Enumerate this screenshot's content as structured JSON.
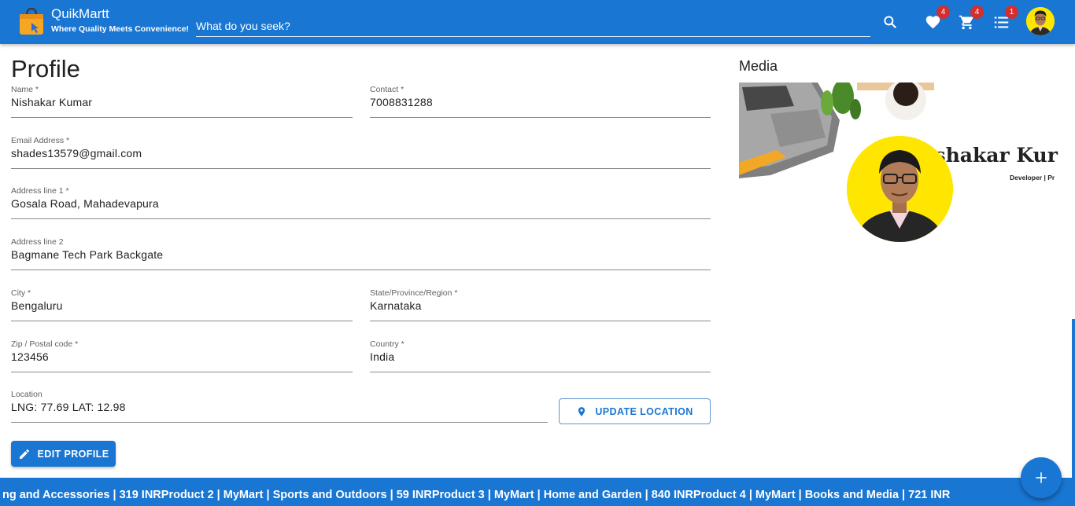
{
  "header": {
    "brand_name": "QuikMartt",
    "brand_tagline": "Where Quality Meets Convenience!",
    "search_placeholder": "What do you seek?",
    "wishlist_count": "4",
    "cart_count": "4",
    "orders_count": "1"
  },
  "profile": {
    "title": "Profile",
    "fields": {
      "name": {
        "label": "Name *",
        "value": "Nishakar Kumar"
      },
      "contact": {
        "label": "Contact *",
        "value": "7008831288"
      },
      "email": {
        "label": "Email Address *",
        "value": "shades13579@gmail.com"
      },
      "address1": {
        "label": "Address line 1 *",
        "value": "Gosala Road, Mahadevapura"
      },
      "address2": {
        "label": "Address line 2",
        "value": "Bagmane Tech Park Backgate"
      },
      "city": {
        "label": "City *",
        "value": "Bengaluru"
      },
      "state": {
        "label": "State/Province/Region *",
        "value": "Karnataka"
      },
      "zip": {
        "label": "Zip / Postal code *",
        "value": "123456"
      },
      "country": {
        "label": "Country *",
        "value": "India"
      },
      "location": {
        "label": "Location",
        "value": "LNG: 77.69 LAT: 12.98"
      }
    },
    "update_location_label": "UPDATE LOCATION",
    "edit_profile_label": "EDIT PROFILE"
  },
  "media": {
    "title": "Media",
    "banner_name": "ishakar Kur",
    "banner_subtitle": "Developer | Pr"
  },
  "ticker": {
    "text": "ng and Accessories | 319 INRProduct 2 | MyMart | Sports and Outdoors | 59 INRProduct 3 | MyMart | Home and Garden | 840 INRProduct 4 | MyMart | Books and Media | 721 INR"
  },
  "colors": {
    "primary": "#1976d2",
    "badge": "#d32f2f",
    "avatar_bg": "#ffe600"
  },
  "icons": [
    "shopping-bag-icon",
    "search-icon",
    "heart-icon",
    "cart-icon",
    "list-icon",
    "location-pin-icon",
    "pencil-icon",
    "plus-icon"
  ]
}
